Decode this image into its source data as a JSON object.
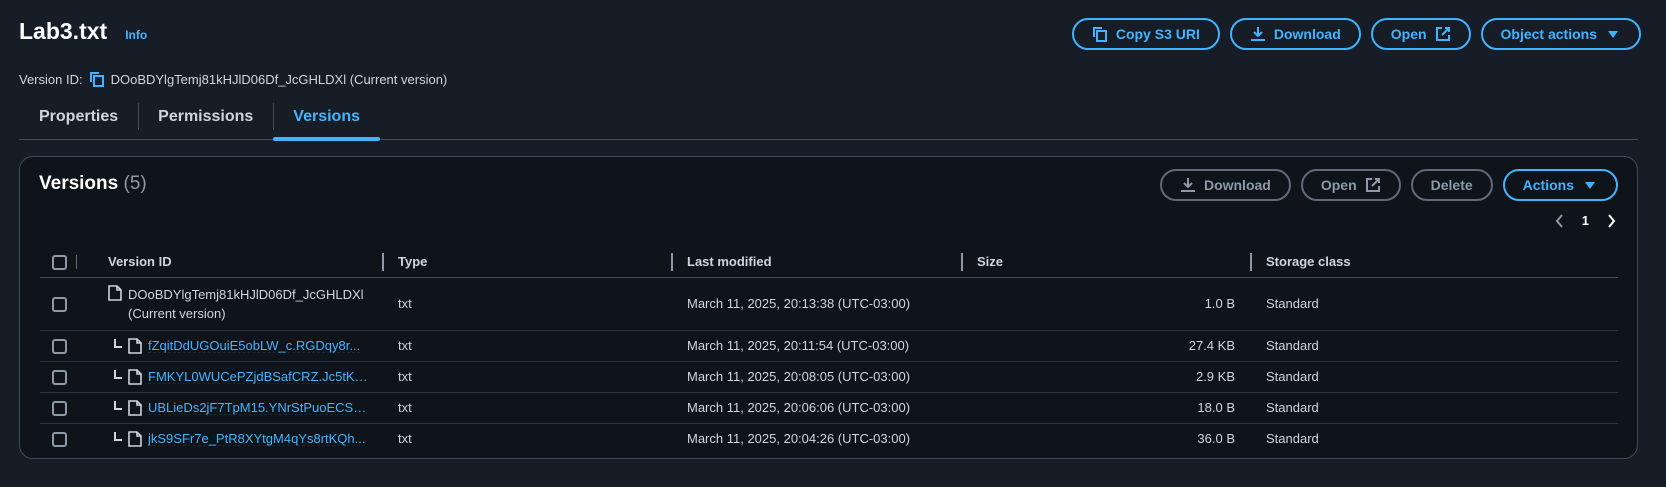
{
  "header": {
    "title": "Lab3.txt",
    "info_label": "Info",
    "buttons": {
      "copy_s3_uri": "Copy S3 URI",
      "download": "Download",
      "open": "Open",
      "object_actions": "Object actions"
    },
    "version_id_label": "Version ID:",
    "version_id_value": "DOoBDYlgTemj81kHJlD06Df_JcGHLDXl (Current version)"
  },
  "tabs": [
    {
      "label": "Properties",
      "active": false
    },
    {
      "label": "Permissions",
      "active": false
    },
    {
      "label": "Versions",
      "active": true
    }
  ],
  "versions_panel": {
    "title": "Versions",
    "count": "(5)",
    "buttons": {
      "download": "Download",
      "open": "Open",
      "delete": "Delete",
      "actions": "Actions"
    },
    "page": "1",
    "columns": {
      "version_id": "Version ID",
      "type": "Type",
      "last_modified": "Last modified",
      "size": "Size",
      "storage_class": "Storage class"
    },
    "rows": [
      {
        "version_id": "DOoBDYlgTemj81kHJlD06Df_JcGHLDXl",
        "note": "(Current version)",
        "type": "txt",
        "last_modified": "March 11, 2025, 20:13:38 (UTC-03:00)",
        "size": "1.0 B",
        "storage_class": "Standard"
      },
      {
        "version_id": "fZqitDdUGOuiE5obLW_c.RGDqy8r...",
        "type": "txt",
        "last_modified": "March 11, 2025, 20:11:54 (UTC-03:00)",
        "size": "27.4 KB",
        "storage_class": "Standard"
      },
      {
        "version_id": "FMKYL0WUCePZjdBSafCRZ.Jc5tKr...",
        "type": "txt",
        "last_modified": "March 11, 2025, 20:08:05 (UTC-03:00)",
        "size": "2.9 KB",
        "storage_class": "Standard"
      },
      {
        "version_id": "UBLieDs2jF7TpM15.YNrStPuoECSP...",
        "type": "txt",
        "last_modified": "March 11, 2025, 20:06:06 (UTC-03:00)",
        "size": "18.0 B",
        "storage_class": "Standard"
      },
      {
        "version_id": "jkS9SFr7e_PtR8XYtgM4qYs8rtKQh...",
        "type": "txt",
        "last_modified": "March 11, 2025, 20:04:26 (UTC-03:00)",
        "size": "36.0 B",
        "storage_class": "Standard"
      }
    ]
  },
  "colors": {
    "background": "#161d26",
    "panel": "#0f141a",
    "accent": "#42b4ff",
    "border": "#414d5c",
    "disabled": "#8d99a8"
  },
  "icons": [
    "copy-icon",
    "download-icon",
    "external-link-icon",
    "caret-down-icon",
    "file-icon",
    "chevron-left-icon",
    "chevron-right-icon"
  ]
}
